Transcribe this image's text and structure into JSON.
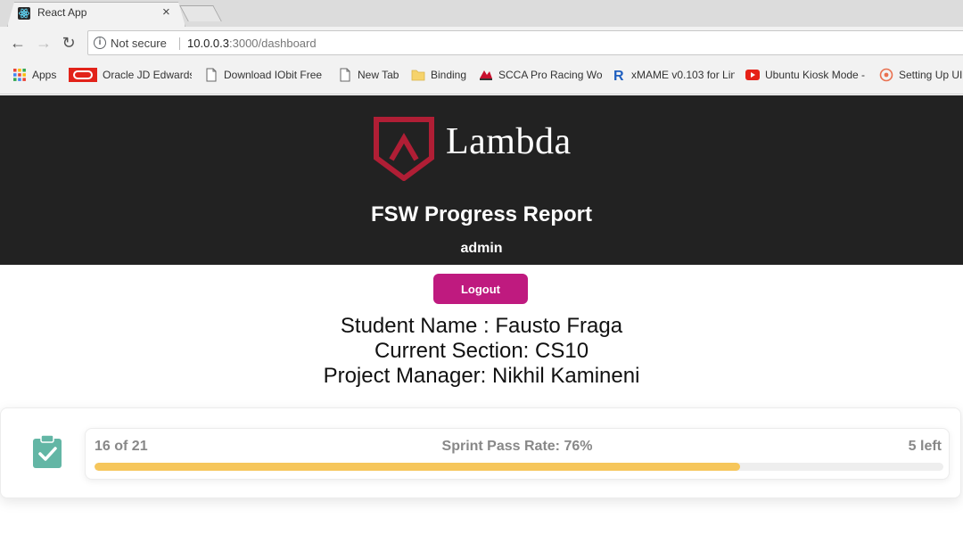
{
  "browser": {
    "tab_title": "React App",
    "tab_close": "×",
    "url_security": "Not secure",
    "url_host": "10.0.0.3",
    "url_path": ":3000/dashboard",
    "bookmarks": [
      {
        "label": "Apps",
        "icon": "apps-grid-icon"
      },
      {
        "label": "Oracle JD Edwards",
        "icon": "oracle-icon"
      },
      {
        "label": "Download IObit Free",
        "icon": "page-icon"
      },
      {
        "label": "New Tab",
        "icon": "page-icon"
      },
      {
        "label": "Binding",
        "icon": "folder-icon"
      },
      {
        "label": "SCCA Pro Racing Wo",
        "icon": "scca-icon"
      },
      {
        "label": "xMAME v0.103 for Lin",
        "icon": "r-logo-icon"
      },
      {
        "label": "Ubuntu Kiosk Mode -",
        "icon": "youtube-icon"
      },
      {
        "label": "Setting Up UI",
        "icon": "circle-logo-icon"
      }
    ]
  },
  "header": {
    "brand": "Lambda",
    "title": "FSW Progress Report",
    "user": "admin",
    "logout_label": "Logout",
    "brand_color": "#b01e35",
    "bg_color": "#222222"
  },
  "student": {
    "name_line": "Student Name : Fausto Fraga",
    "section_line": "Current Section: CS10",
    "pm_line": "Project Manager: Nikhil Kamineni"
  },
  "progress": {
    "completed_text": "16 of 21",
    "pass_rate_text": "Sprint Pass Rate: 76%",
    "remaining_text": "5 left",
    "fraction": 0.76,
    "fill_color": "#f6c65b",
    "icon": "clipboard-check-icon"
  }
}
